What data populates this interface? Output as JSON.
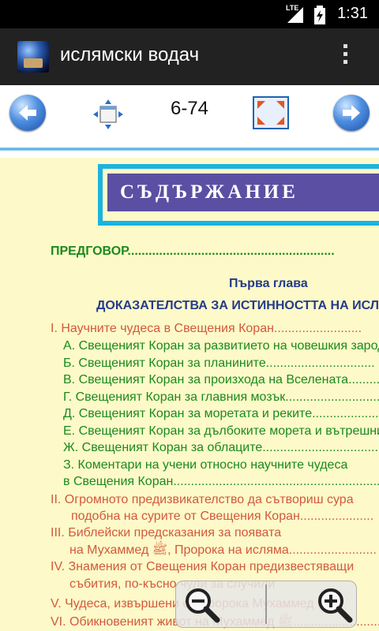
{
  "status_bar": {
    "network": "LTE",
    "time": "1:31"
  },
  "action_bar": {
    "title": "ислямски водач",
    "menu_icon": "overflow-menu-icon"
  },
  "toolbar": {
    "page_indicator": "6-74",
    "prev_icon": "arrow-left-icon",
    "move_icon": "move-window-icon",
    "fullscreen_icon": "fullscreen-icon",
    "next_icon": "arrow-right-icon"
  },
  "document": {
    "banner_title": "СЪДЪРЖАНИЕ",
    "preface": "ПРЕДГОВОР...........................................................",
    "chapter_label": "Първа глава",
    "chapter_title": "ДОКАЗАТЕЛСТВА ЗА ИСТИННОСТТА НА ИСЛЯМА",
    "lines": [
      "I. Научните чудеса в Свещения Коран.........................",
      "А. Свещеният Коран за развитието на човешкия зародиш",
      "Б. Свещеният Коран за планините...............................",
      "В. Свещеният Коран за произхода на Вселената............",
      "Г. Свещеният Коран за главния мозък...........................",
      "Д. Свещеният Коран за моретата и реките......................",
      "Е. Свещеният Коран за дълбоките морета и вътрешните вълни",
      "Ж. Свещеният Коран за облаците..................................",
      "З. Коментари на учени относно научните чудеса",
      "в Свещения Коран...........................................................",
      "II. Огромното предизвикателство да сътвориш сура",
      "подобна на сурите от Свещения Коран.....................",
      "III. Библейски предсказания за появата",
      "на Мухаммед ﷺ, Пророка на исляма.........................",
      "IV. Знамения от Свещения Коран предизвестяващи",
      "събития, по-късно чули за случили",
      "V. Чудеса, извършени от Пророка Мухаммед",
      "VI. Обикновеният живот на Мухаммед ﷺ..........................."
    ]
  },
  "zoom_controls": {
    "zoom_out_icon": "zoom-out-icon",
    "zoom_in_icon": "zoom-in-icon"
  }
}
